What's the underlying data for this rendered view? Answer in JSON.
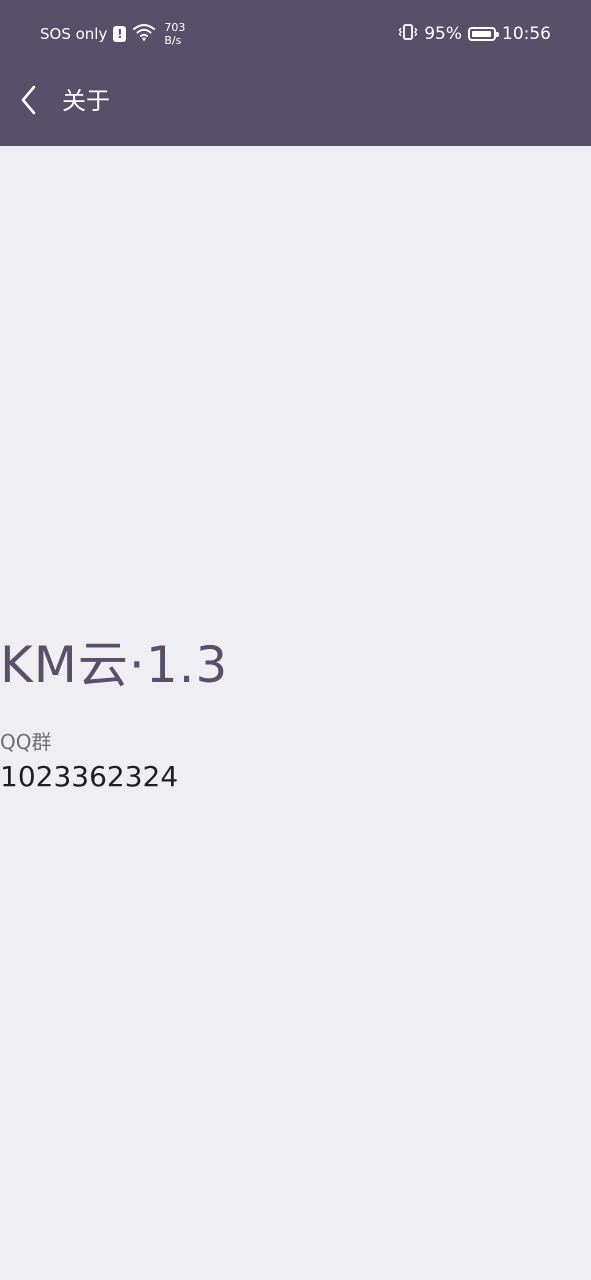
{
  "status_bar": {
    "sos": "SOS only",
    "alert_mark": "!",
    "net_speed_value": "703",
    "net_speed_unit": "B/s",
    "battery": "95%",
    "time": "10:56"
  },
  "header": {
    "title": "关于"
  },
  "about": {
    "app_version": "KM云·1.3",
    "qq_label": "QQ群",
    "qq_number": "1023362324"
  },
  "colors": {
    "header_bg": "#585068",
    "page_bg": "#efeff3",
    "accent": "#585068"
  },
  "icons": {
    "back": "back-arrow-icon",
    "wifi": "wifi-icon",
    "vibrate": "vibrate-icon",
    "battery": "battery-icon",
    "alert": "alert-icon"
  }
}
